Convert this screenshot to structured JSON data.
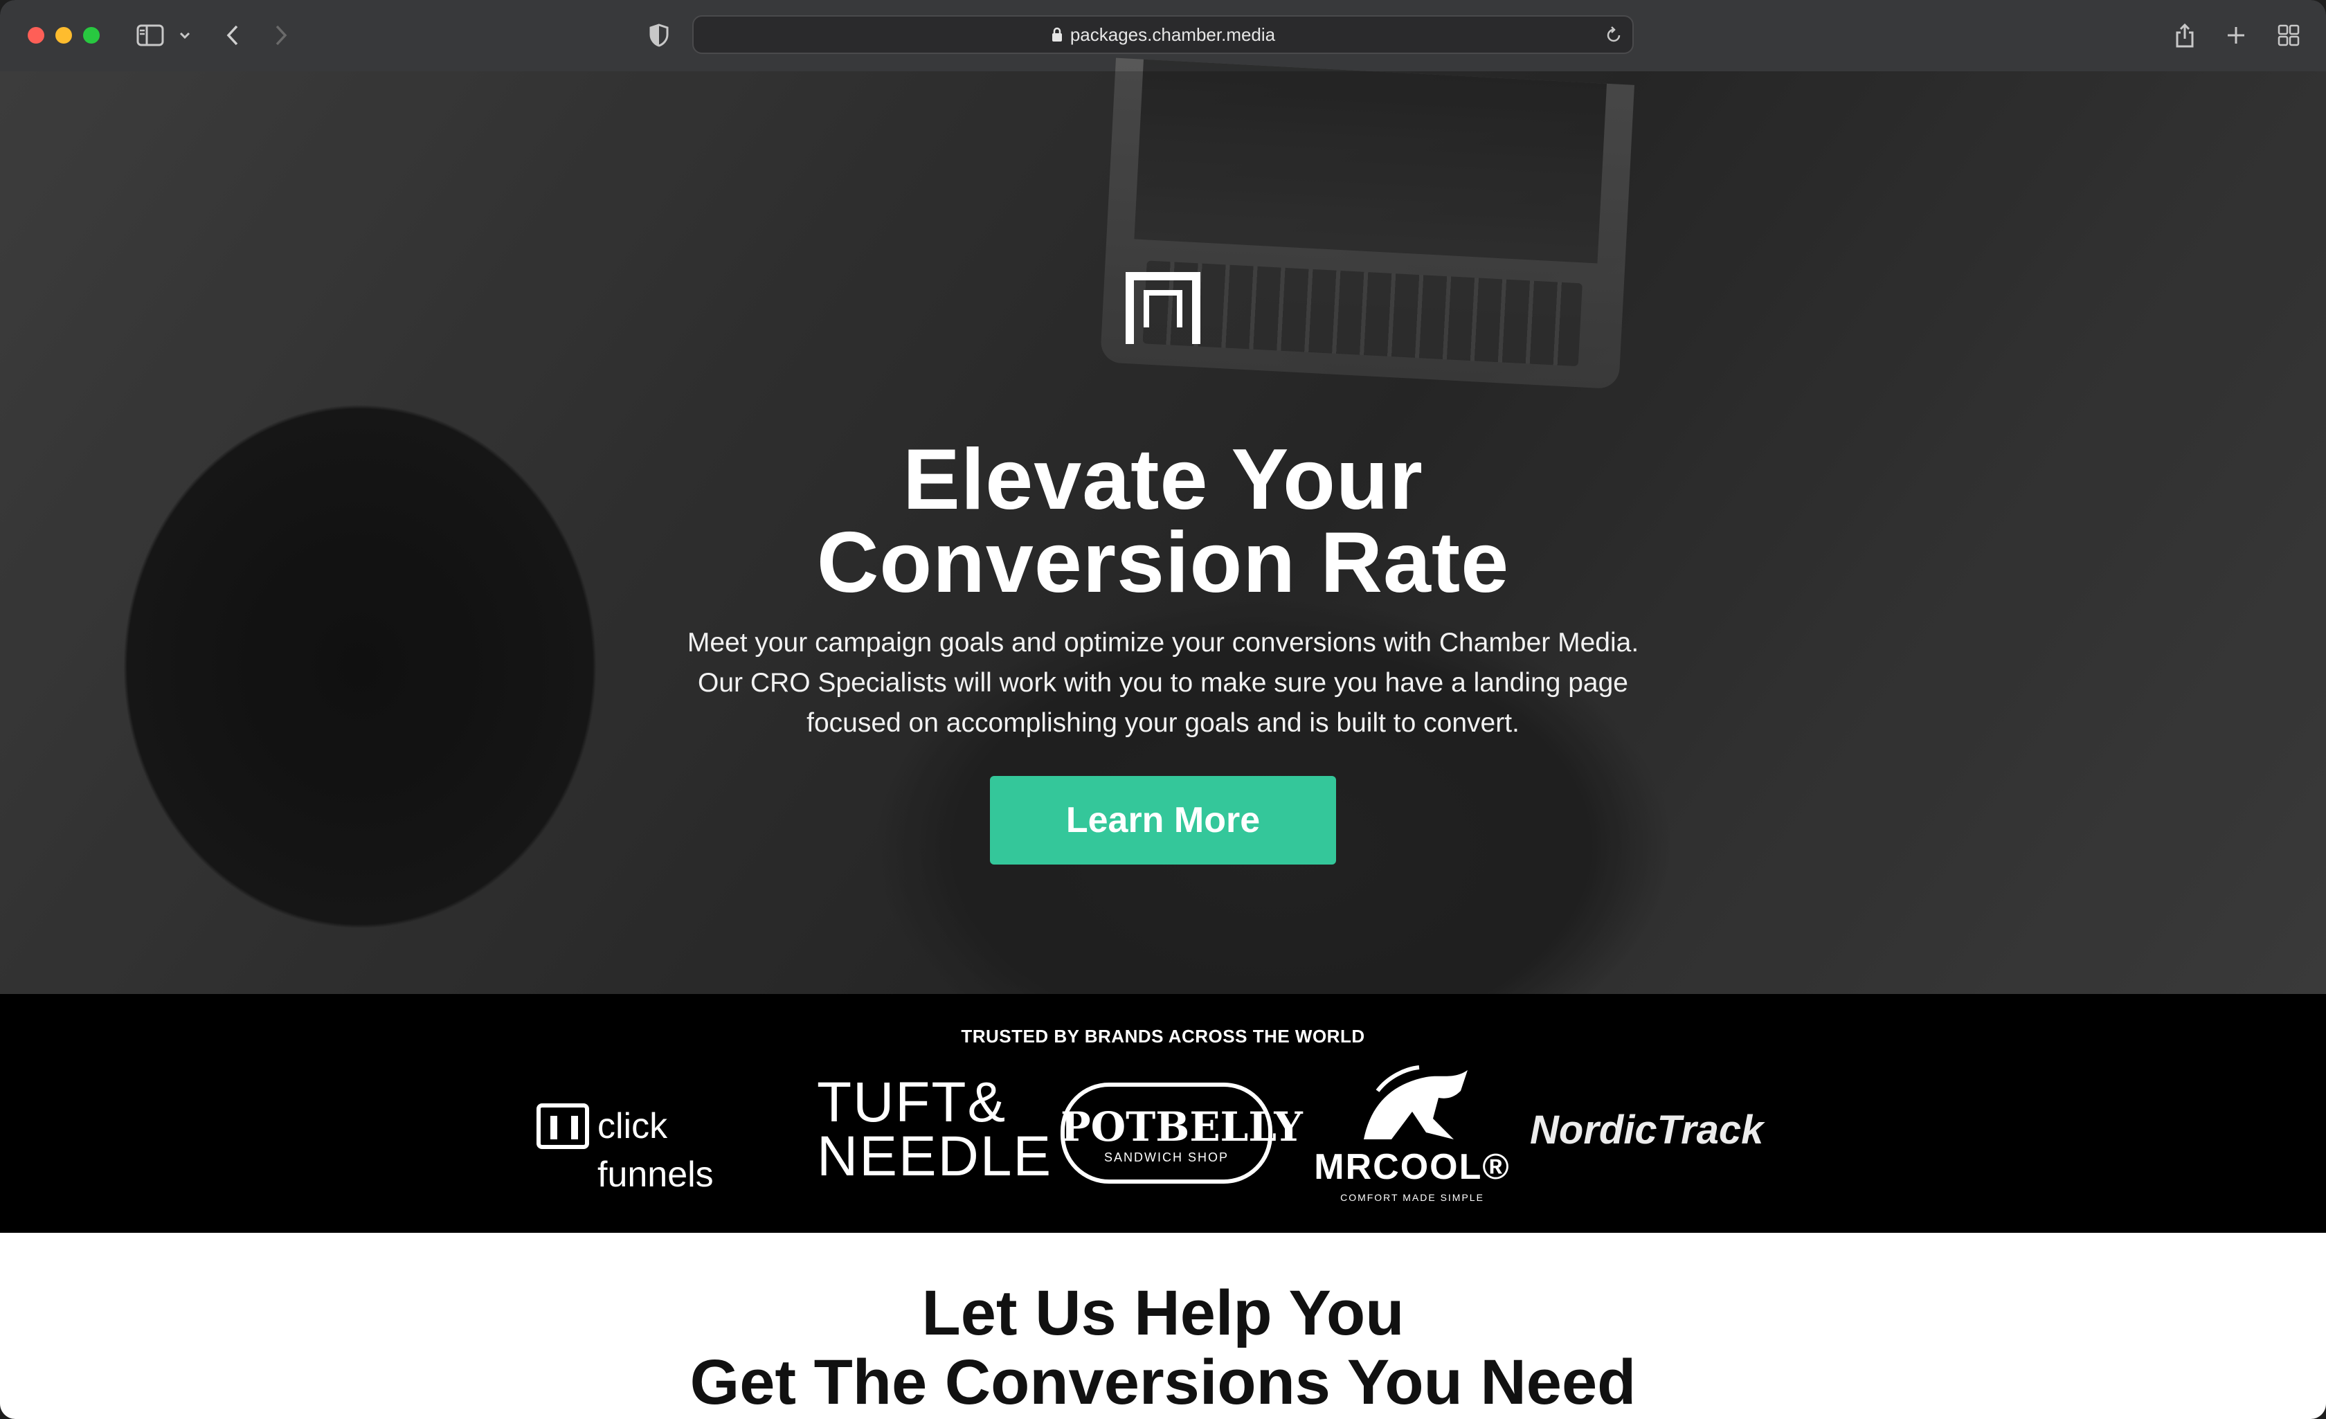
{
  "browser": {
    "url": "packages.chamber.media"
  },
  "hero": {
    "title_line1": "Elevate Your",
    "title_line2": "Conversion Rate",
    "body_line1": "Meet your campaign goals and optimize your conversions with Chamber Media.",
    "body_line2": "Our CRO Specialists will work with you to make sure you have a landing page",
    "body_line3": "focused on accomplishing your goals and is built to convert.",
    "cta_label": "Learn More",
    "accent_color": "#34c79a"
  },
  "brands": {
    "label": "TRUSTED BY BRANDS ACROSS THE WORLD",
    "items": [
      {
        "name": "click funnels",
        "icon": "clickfunnels-logo"
      },
      {
        "line1": "TUFT&",
        "line2": "NEEDLE",
        "icon": "tuft-and-needle-logo"
      },
      {
        "name": "POTBELLY",
        "sub": "SANDWICH SHOP",
        "icon": "potbelly-logo"
      },
      {
        "name": "MRCOOL®",
        "sub": "COMFORT MADE SIMPLE",
        "icon": "mrcool-logo"
      },
      {
        "name": "NordicTrack",
        "icon": "nordictrack-logo"
      }
    ]
  },
  "section": {
    "title_line1": "Let Us Help You",
    "title_line2": "Get The Conversions You Need"
  }
}
